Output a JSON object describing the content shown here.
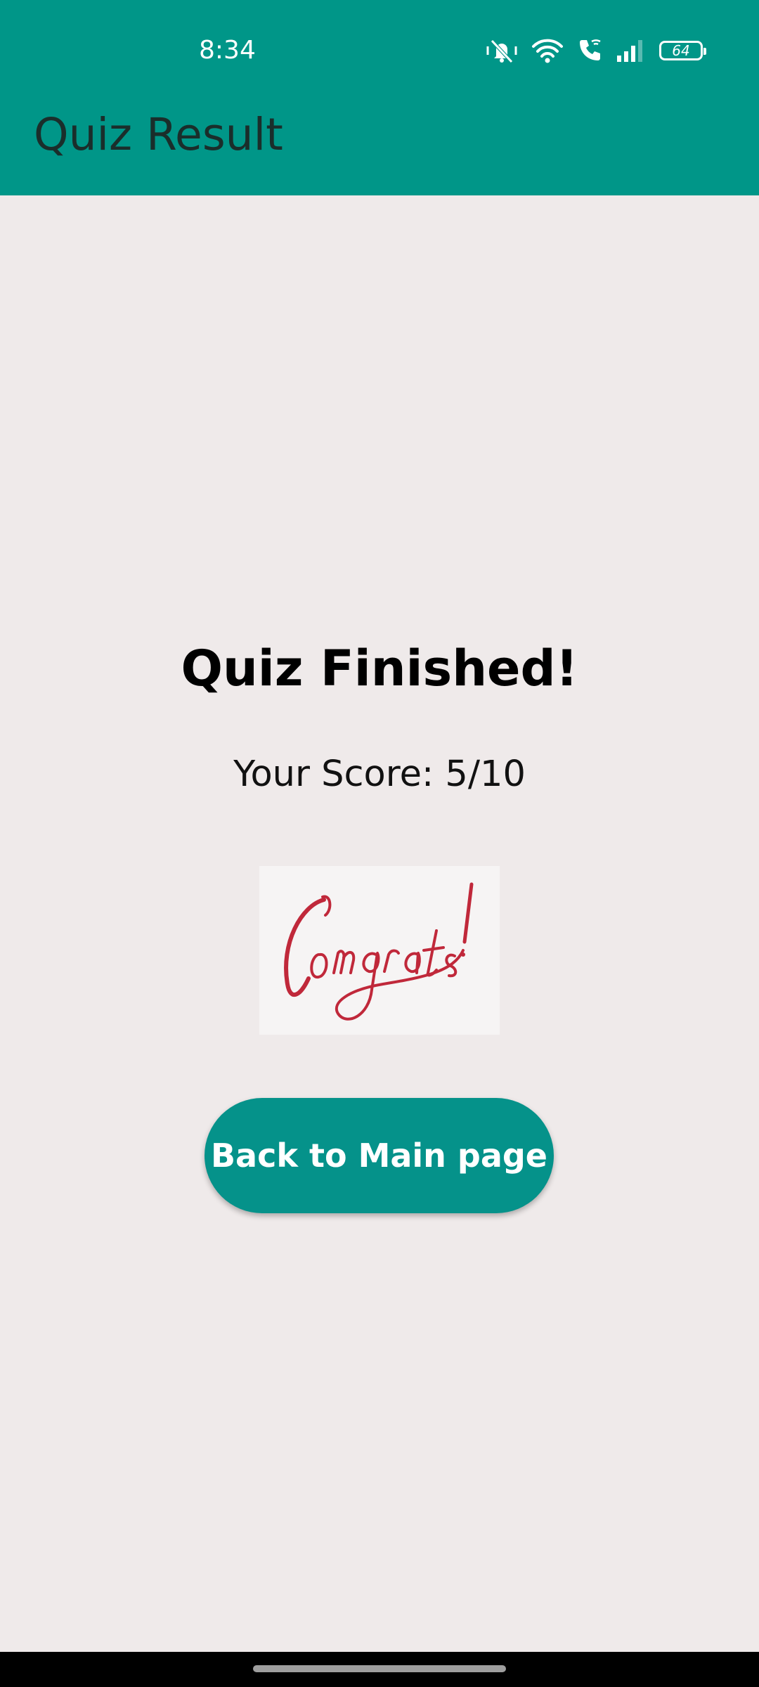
{
  "status_bar": {
    "time": "8:34",
    "battery_level": "64",
    "icons": [
      "mute-vibrate-icon",
      "wifi-icon",
      "wifi-calling-icon",
      "signal-icon",
      "battery-icon"
    ]
  },
  "app_bar": {
    "title": "Quiz Result",
    "color": "#009688"
  },
  "result": {
    "heading": "Quiz Finished!",
    "score_text": "Your Score: 5/10",
    "image_text": "Congrats!"
  },
  "actions": {
    "back_label": "Back to Main page",
    "button_color": "#05928a"
  }
}
